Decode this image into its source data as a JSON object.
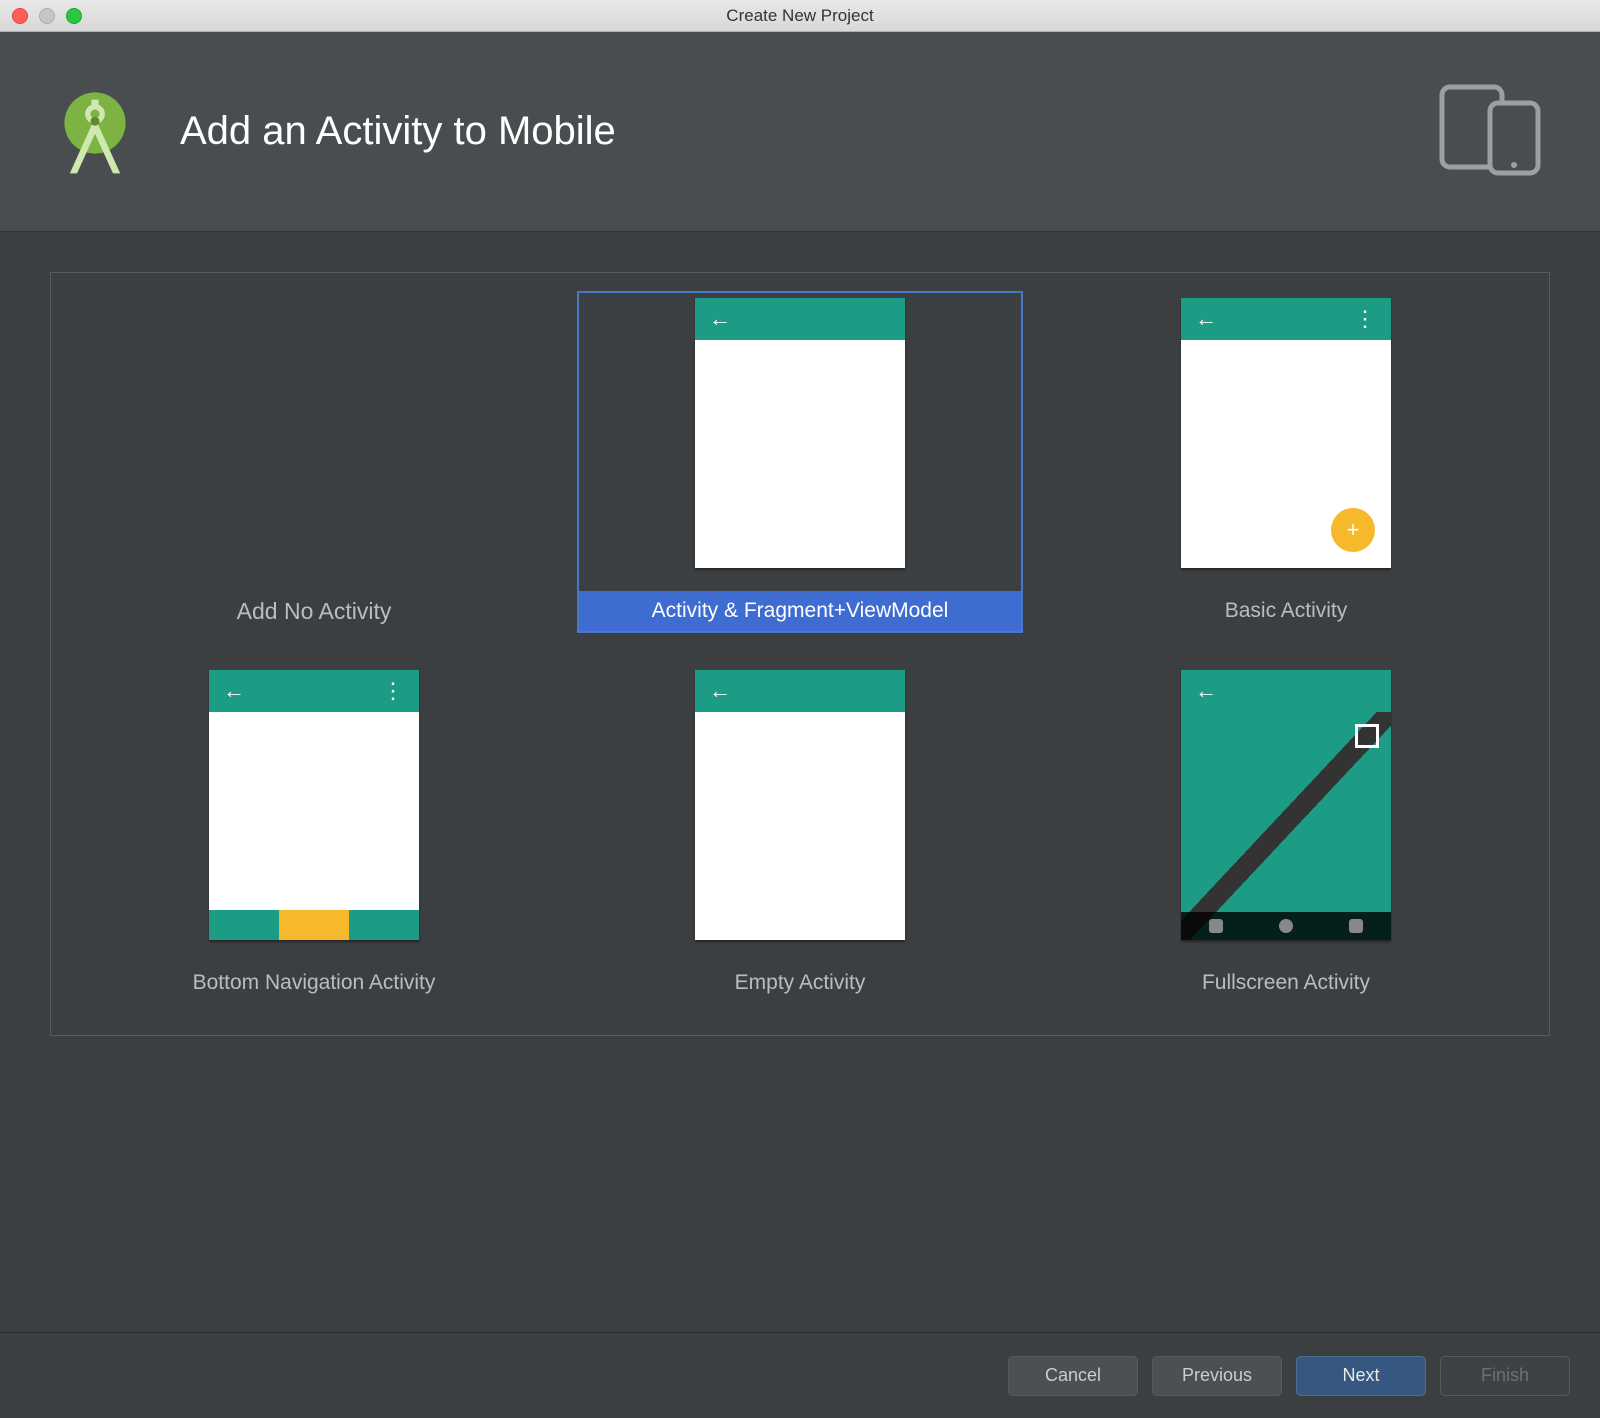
{
  "window": {
    "title": "Create New Project"
  },
  "header": {
    "title": "Add an Activity to Mobile"
  },
  "selected_index": 1,
  "templates": [
    {
      "label": "Add No Activity",
      "kind": "none"
    },
    {
      "label": "Activity & Fragment+ViewModel",
      "kind": "empty"
    },
    {
      "label": "Basic Activity",
      "kind": "basic"
    },
    {
      "label": "Bottom Navigation Activity",
      "kind": "bottomnav"
    },
    {
      "label": "Empty Activity",
      "kind": "empty"
    },
    {
      "label": "Fullscreen Activity",
      "kind": "fullscreen"
    }
  ],
  "buttons": {
    "cancel": "Cancel",
    "previous": "Previous",
    "next": "Next",
    "finish": "Finish"
  }
}
